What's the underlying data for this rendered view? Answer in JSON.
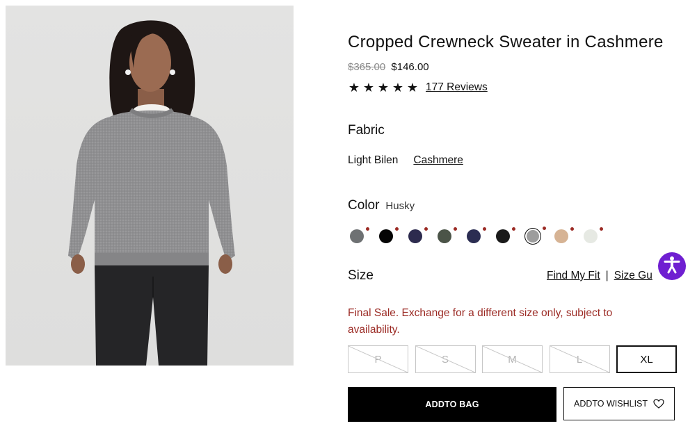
{
  "product": {
    "title": "Cropped Crewneck Sweater in Cashmere",
    "price_original": "$365.00",
    "price_sale": "$146.00",
    "rating_stars": 5,
    "reviews_label": "177 Reviews"
  },
  "fabric": {
    "heading": "Fabric",
    "options": [
      {
        "label": "Light Bilen",
        "selected": false
      },
      {
        "label": "Cashmere",
        "selected": true
      }
    ]
  },
  "color": {
    "heading": "Color",
    "selected_name": "Husky",
    "swatches": [
      {
        "color": "#6e7173",
        "selected": false
      },
      {
        "color": "#050505",
        "selected": false
      },
      {
        "color": "#2d2b4e",
        "selected": false
      },
      {
        "color": "#4b5448",
        "selected": false
      },
      {
        "color": "#2b2d52",
        "selected": false
      },
      {
        "color": "#1a1a1a",
        "selected": false
      },
      {
        "color": "#9d9d9d",
        "selected": true
      },
      {
        "color": "#d6b394",
        "selected": false
      },
      {
        "color": "#e6e9e3",
        "selected": false
      }
    ],
    "swatch_dot_color": "#9b2a24"
  },
  "size": {
    "heading": "Size",
    "find_my_fit_label": "Find My Fit",
    "separator": "|",
    "size_guide_label": "Size Gu",
    "final_sale_note": "Final Sale. Exchange for a different size only, subject to availability.",
    "options": [
      {
        "label": "P",
        "available": false
      },
      {
        "label": "S",
        "available": false
      },
      {
        "label": "M",
        "available": false
      },
      {
        "label": "L",
        "available": false
      },
      {
        "label": "XL",
        "available": true
      }
    ]
  },
  "actions": {
    "add_to_bag_label": "ADDTO BAG",
    "add_to_wishlist_label": "ADDTO WISHLIST"
  },
  "icons": {
    "star": "star-icon",
    "heart": "heart-icon",
    "accessibility": "accessibility-icon"
  },
  "colors": {
    "sale_note": "#9b2a24",
    "accessibility_button": "#6f1fd1",
    "primary_button": "#000000"
  }
}
